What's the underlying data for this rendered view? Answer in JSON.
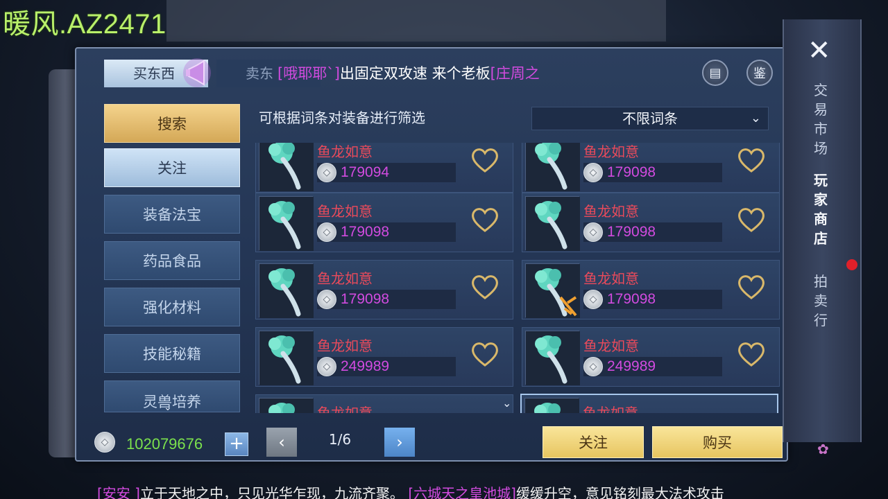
{
  "watermark": "暖风.AZ2471",
  "tabs": {
    "buy": "买东西",
    "sell": "卖东"
  },
  "ticker": {
    "sender": "[哦耶耶`]",
    "message": "出固定双攻速 来个老板",
    "next_sender": "[庄周之"
  },
  "top_icons": {
    "magnify": "▤",
    "appraise": "鉴"
  },
  "sidebar": {
    "items": [
      {
        "label": "搜索"
      },
      {
        "label": "关注"
      },
      {
        "label": "装备法宝"
      },
      {
        "label": "药品食品"
      },
      {
        "label": "强化材料"
      },
      {
        "label": "技能秘籍"
      },
      {
        "label": "灵兽培养"
      }
    ]
  },
  "filter": {
    "label": "可根据词条对装备进行筛选",
    "selected": "不限词条"
  },
  "items": [
    {
      "name": "鱼龙如意",
      "price": "179094"
    },
    {
      "name": "鱼龙如意",
      "price": "179098"
    },
    {
      "name": "鱼龙如意",
      "price": "179098"
    },
    {
      "name": "鱼龙如意",
      "price": "179098"
    },
    {
      "name": "鱼龙如意",
      "price": "179098"
    },
    {
      "name": "鱼龙如意",
      "price": "179098"
    },
    {
      "name": "鱼龙如意",
      "price": "249989"
    },
    {
      "name": "鱼龙如意",
      "price": "249989"
    },
    {
      "name": "鱼龙如意",
      "price": ""
    },
    {
      "name": "鱼龙如意",
      "price": ""
    }
  ],
  "wallet": {
    "amount": "102079676",
    "plus": "+"
  },
  "pagination": {
    "prev": "‹",
    "current": "1/6",
    "next": "›"
  },
  "actions": {
    "follow": "关注",
    "buy": "购买"
  },
  "right_menu": {
    "close": "✕",
    "items": [
      {
        "label": "交易市场"
      },
      {
        "label": "玩家商店"
      },
      {
        "label": "拍卖行"
      }
    ]
  },
  "chat": {
    "sender": "[安安 ]",
    "text": "立于天地之中，只见光华乍现，九流齐聚。",
    "sender2": "[六城天之皇池城]",
    "text2": "缓缓升空，意见铭刻最大法术攻击"
  },
  "colors": {
    "item_name": "#ea4a5b",
    "price": "#d24be0",
    "wallet": "#7be14d",
    "gold_button": "#e7c560"
  },
  "icons": {
    "coin": "coin-icon",
    "heart": "heart-icon",
    "horn": "megaphone-icon",
    "close": "close-icon"
  }
}
